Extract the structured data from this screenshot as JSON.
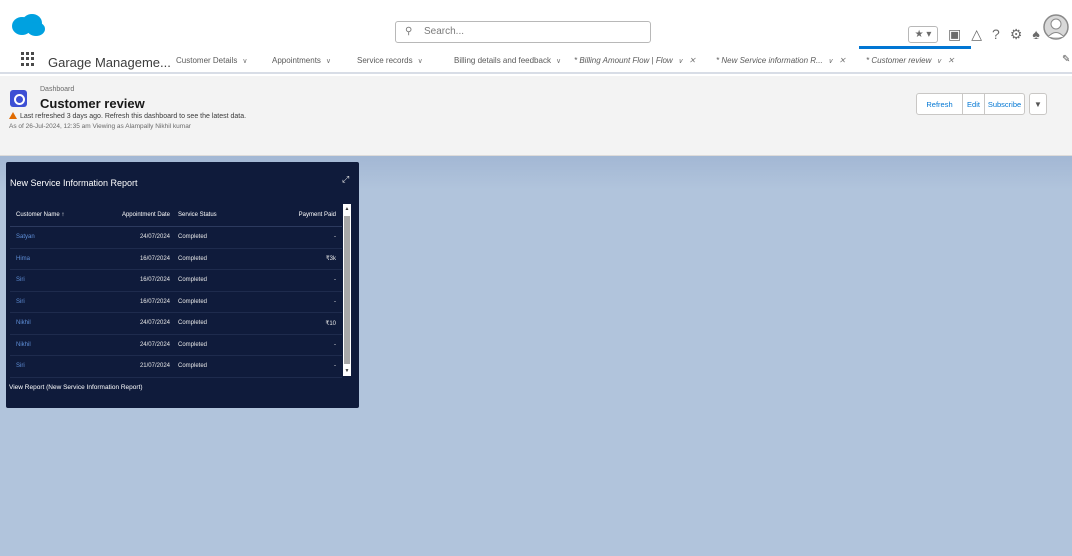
{
  "header": {
    "search_placeholder": "Search...",
    "favorites_label": "★ ▾",
    "icons": [
      "plus-square-icon",
      "trailhead-icon",
      "help-icon",
      "gear-icon",
      "bell-icon",
      "avatar"
    ],
    "brand_color": "#00a1e0"
  },
  "nav": {
    "app_name": "Garage Manageme...",
    "items": [
      {
        "label": "Customer Details",
        "type": "dropdown"
      },
      {
        "label": "Appointments",
        "type": "dropdown"
      },
      {
        "label": "Service records",
        "type": "dropdown"
      },
      {
        "label": "Billing details and feedback",
        "type": "dropdown"
      },
      {
        "label": "* Billing Amount Flow | Flow",
        "type": "tab"
      },
      {
        "label": "* New Service information R...",
        "type": "tab"
      },
      {
        "label": "* Customer review",
        "type": "tab",
        "active": true
      }
    ]
  },
  "dashboard": {
    "type_label": "Dashboard",
    "title": "Customer review",
    "warning": "Last refreshed 3 days ago. Refresh this dashboard to see the latest data.",
    "as_of": "As of 26-Jul-2024, 12:35 am Viewing as Alampally Nikhil kumar",
    "buttons": {
      "refresh": "Refresh",
      "edit": "Edit",
      "subscribe": "Subscribe",
      "more": "▼"
    }
  },
  "widget": {
    "title": "New Service Information Report",
    "columns": [
      "Customer Name ↑",
      "Appointment Date",
      "Service Status",
      "Payment Paid"
    ],
    "rows": [
      [
        "Satyan",
        "24/07/2024",
        "Completed",
        "-"
      ],
      [
        "Hima",
        "16/07/2024",
        "Completed",
        "₹3k"
      ],
      [
        "Siri",
        "16/07/2024",
        "Completed",
        "-"
      ],
      [
        "Siri",
        "16/07/2024",
        "Completed",
        "-"
      ],
      [
        "Nikhil",
        "24/07/2024",
        "Completed",
        "₹10"
      ],
      [
        "Nikhil",
        "24/07/2024",
        "Completed",
        "-"
      ],
      [
        "Siri",
        "21/07/2024",
        "Completed",
        "-"
      ]
    ],
    "view_report": "View Report (New Service Information Report)"
  }
}
